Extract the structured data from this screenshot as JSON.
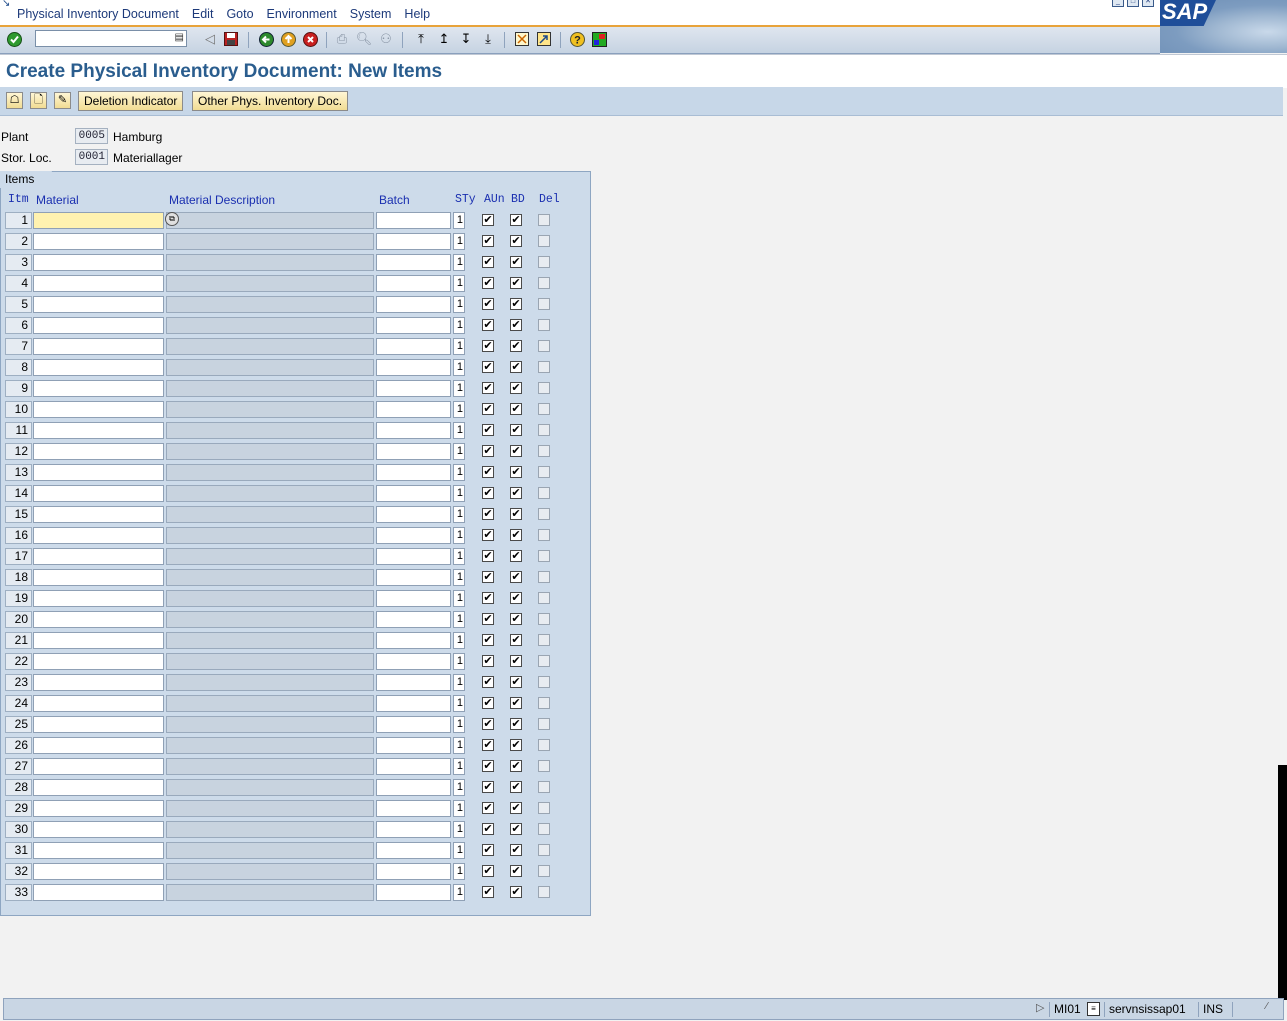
{
  "menu": {
    "items": [
      "Physical Inventory Document",
      "Edit",
      "Goto",
      "Environment",
      "System",
      "Help"
    ]
  },
  "logo": {
    "text": "SAP"
  },
  "toolbar": {
    "command_value": ""
  },
  "title": "Create Physical Inventory Document: New Items",
  "app_toolbar": {
    "deletion_indicator": "Deletion Indicator",
    "other_doc": "Other Phys. Inventory Doc."
  },
  "header": {
    "plant_label": "Plant",
    "plant_value": "0005",
    "plant_desc": "Hamburg",
    "sloc_label": "Stor. Loc.",
    "sloc_value": "0001",
    "sloc_desc": "Materiallager"
  },
  "items": {
    "tab_label": "Items",
    "columns": {
      "itm": "Itm",
      "material": "Material",
      "description": "Material Description",
      "batch": "Batch",
      "sty": "STy",
      "aun": "AUn",
      "bd": "BD",
      "del": "Del"
    },
    "row_count": 33,
    "default_sty": "1",
    "aun_checked": true,
    "bd_checked": true,
    "del_checked": false
  },
  "status": {
    "transaction": "MI01",
    "server": "servnsissap01",
    "mode": "INS"
  }
}
